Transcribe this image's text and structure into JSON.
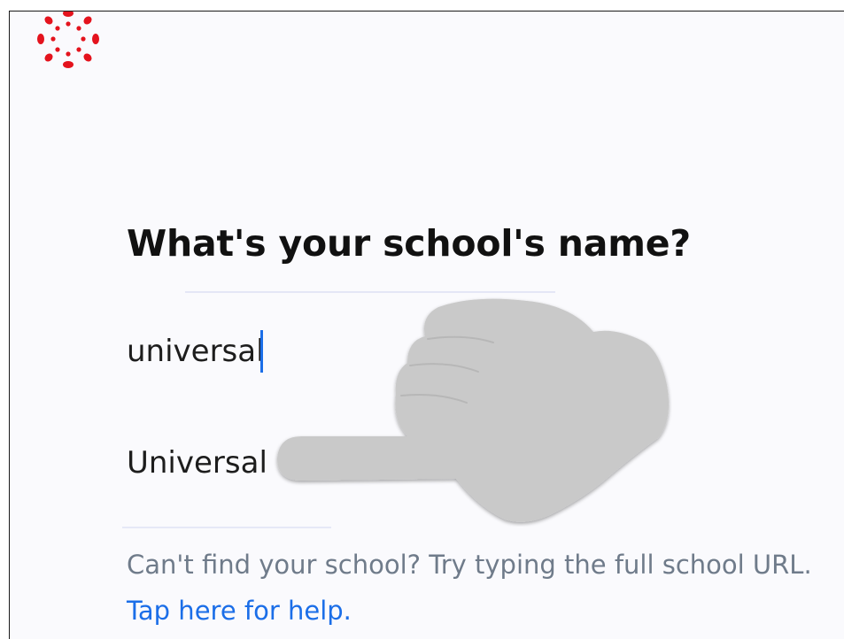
{
  "app": {
    "logo_icon": "canvas-logo-icon",
    "brand_color": "#e4131d"
  },
  "prompt": {
    "heading": "What's your school's name?"
  },
  "search": {
    "value": "universal"
  },
  "suggestions": [
    {
      "label": "Universal"
    }
  ],
  "help": {
    "text": "Can't find your school? Try typing the full school URL.",
    "link_label": "Tap here for help.",
    "link_color": "#1b6ee8"
  },
  "overlay": {
    "icon": "pointing-hand-icon",
    "color": "#c9c9c9"
  }
}
